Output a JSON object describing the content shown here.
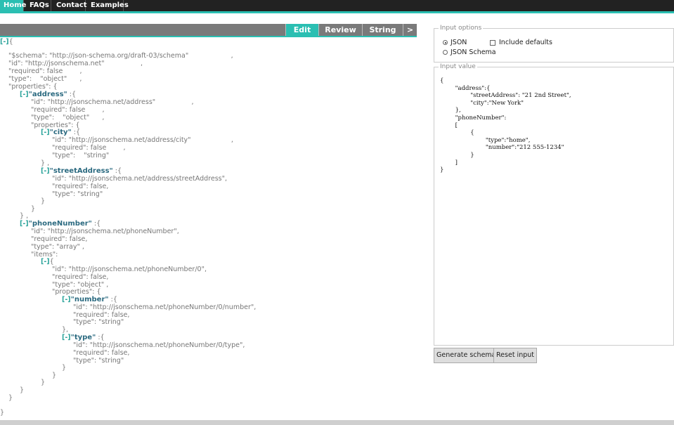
{
  "nav": {
    "items": [
      "Home",
      "FAQs",
      "Contact",
      "Examples"
    ],
    "active": "Home"
  },
  "editor_tabs": {
    "items": [
      "Edit",
      "Review",
      "String",
      ">"
    ],
    "active": "Edit"
  },
  "tree": {
    "lines": [
      {
        "toggle": "[-]",
        "text": "{"
      },
      {
        "text": "\"$schema\": \"http://json-schema.org/draft-03/schema\"                    ,"
      },
      {
        "text": "\"id\": \"http://jsonschema.net\"                 ,"
      },
      {
        "text": "\"required\": false        ,"
      },
      {
        "text": "\"type\":    \"object\"      ,"
      },
      {
        "text": "\"properties\": {"
      },
      {
        "toggle": "[-]",
        "key": "\"address\"",
        "text": " :{"
      },
      {
        "text": "\"id\": \"http://jsonschema.net/address\"                 ,"
      },
      {
        "text": "\"required\": false        ,"
      },
      {
        "text": "\"type\":    \"object\"      ,"
      },
      {
        "text": "\"properties\": {"
      },
      {
        "toggle": "[-]",
        "key": "\"city\"",
        "text": " :{"
      },
      {
        "text": "\"id\": \"http://jsonschema.net/address/city\"                   ,"
      },
      {
        "text": "\"required\": false        ,"
      },
      {
        "text": "\"type\":    \"string\""
      },
      {
        "text": "} ,"
      },
      {
        "toggle": "[-]",
        "key": "\"streetAddress\"",
        "text": " :{"
      },
      {
        "text": "\"id\": \"http://jsonschema.net/address/streetAddress\","
      },
      {
        "text": "\"required\": false,"
      },
      {
        "text": "\"type\": \"string\""
      },
      {
        "text": "}"
      },
      {
        "text": "}"
      },
      {
        "text": "} ,"
      },
      {
        "toggle": "[-]",
        "key": "\"phoneNumber\"",
        "text": " :{"
      },
      {
        "text": "\"id\": \"http://jsonschema.net/phoneNumber\","
      },
      {
        "text": "\"required\": false,"
      },
      {
        "text": "\"type\": \"array\" ,"
      },
      {
        "text": "\"items\":"
      },
      {
        "toggle": "[-]",
        "text": "{"
      },
      {
        "text": "\"id\": \"http://jsonschema.net/phoneNumber/0\","
      },
      {
        "text": "\"required\": false,"
      },
      {
        "text": "\"type\": \"object\" ,"
      },
      {
        "text": "\"properties\": {"
      },
      {
        "toggle": "[-]",
        "key": "\"number\"",
        "text": " :{"
      },
      {
        "text": "\"id\": \"http://jsonschema.net/phoneNumber/0/number\","
      },
      {
        "text": "\"required\": false,"
      },
      {
        "text": "\"type\": \"string\""
      },
      {
        "text": "},"
      },
      {
        "toggle": "[-]",
        "key": "\"type\"",
        "text": " :{"
      },
      {
        "text": "\"id\": \"http://jsonschema.net/phoneNumber/0/type\","
      },
      {
        "text": "\"required\": false,"
      },
      {
        "text": "\"type\": \"string\""
      },
      {
        "text": "}"
      },
      {
        "text": "}"
      },
      {
        "text": "}"
      },
      {
        "text": "}"
      },
      {
        "text": "}"
      },
      {
        "text": "}"
      }
    ]
  },
  "input_options": {
    "legend": "Input options",
    "json_label": "JSON",
    "schema_label": "JSON Schema",
    "include_defaults_label": "Include defaults",
    "selected": "JSON",
    "include_defaults": false
  },
  "input_value": {
    "legend": "Input value",
    "lines": [
      "{",
      "        \"address\":{",
      "                \"streetAddress\": \"21 2nd Street\",",
      "                \"city\":\"New York\"",
      "        },",
      "        \"phoneNumber\":",
      "        [",
      "                {",
      "                        \"type\":\"home\",",
      "                        \"number\":\"212 555-1234\"",
      "                }",
      "        ]",
      "}"
    ]
  },
  "buttons": {
    "generate": "Generate schema",
    "reset": "Reset input"
  },
  "colors": {
    "accent": "#2bbfb2",
    "nav_bg": "#222222",
    "toolbar_bg": "#7a7a7a"
  }
}
